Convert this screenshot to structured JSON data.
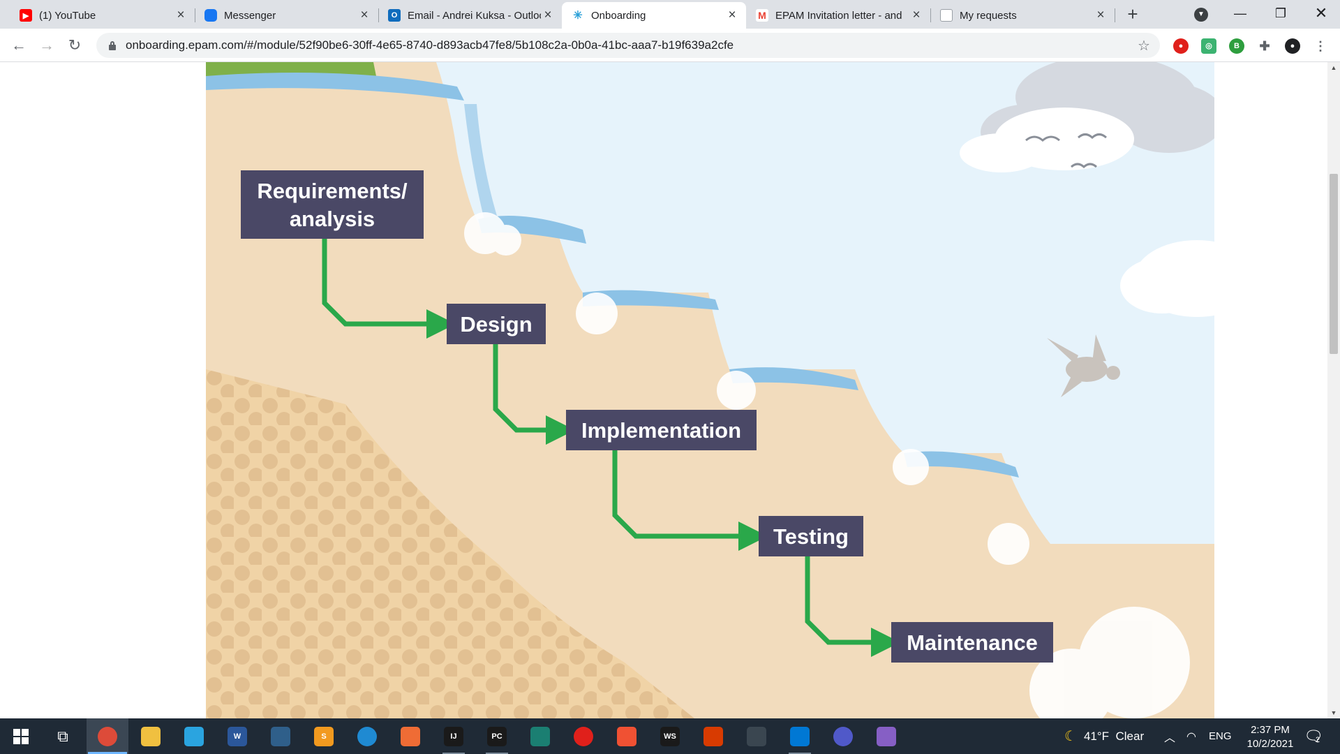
{
  "browser": {
    "tabs": [
      {
        "label": "(1) YouTube",
        "icon": "youtube-icon",
        "color": "#ff0000"
      },
      {
        "label": "Messenger",
        "icon": "messenger-icon",
        "color": "#1877f2"
      },
      {
        "label": "Email - Andrei Kuksa - Outlook",
        "icon": "outlook-icon",
        "color": "#0f6cbd"
      },
      {
        "label": "Onboarding",
        "icon": "onboarding-icon",
        "color": "#2aa0d8"
      },
      {
        "label": "EPAM Invitation letter - and",
        "icon": "gmail-icon",
        "color": "#ea4335"
      },
      {
        "label": "My requests",
        "icon": "document-icon",
        "color": "#9aa0a6"
      }
    ],
    "active_tab": 3,
    "url": "onboarding.epam.com/#/module/52f90be6-30ff-4e65-8740-d893acb47fe8/5b108c2a-0b0a-41bc-aaa7-b19f639a2cfe"
  },
  "diagram": {
    "steps": [
      "Requirements/\nanalysis",
      "Design",
      "Implementation",
      "Testing",
      "Maintenance"
    ],
    "colors": {
      "box": "#4a4866",
      "arrow": "#2aa84a",
      "sky": "#e6f3fb",
      "cliff": "#f2dcbd",
      "water": "#8cc2e6",
      "grass": "#7fb04a"
    }
  },
  "taskbar": {
    "apps": [
      {
        "name": "chrome-app",
        "label": "",
        "color": "#dd4b39"
      },
      {
        "name": "file-explorer-app",
        "label": "",
        "color": "#f0c040"
      },
      {
        "name": "telegram-app",
        "label": "",
        "color": "#2aa4e0"
      },
      {
        "name": "word-app",
        "label": "W",
        "color": "#2b579a"
      },
      {
        "name": "mysql-workbench-app",
        "label": "",
        "color": "#2f5f8a"
      },
      {
        "name": "sublime-text-app",
        "label": "S",
        "color": "#f29a1f"
      },
      {
        "name": "edge-app",
        "label": "",
        "color": "#1f8ad2"
      },
      {
        "name": "postman-app",
        "label": "",
        "color": "#ef6c35"
      },
      {
        "name": "intellij-idea-app",
        "label": "IJ",
        "color": "#1a1a1a"
      },
      {
        "name": "pycharm-app",
        "label": "PC",
        "color": "#1a1a1a"
      },
      {
        "name": "gitkraken-app",
        "label": "",
        "color": "#1b7f72"
      },
      {
        "name": "opera-app",
        "label": "",
        "color": "#e0201b"
      },
      {
        "name": "git-app",
        "label": "",
        "color": "#f05133"
      },
      {
        "name": "webstorm-app",
        "label": "WS",
        "color": "#1a1a1a"
      },
      {
        "name": "office-app",
        "label": "",
        "color": "#d83b01"
      },
      {
        "name": "vpn-app",
        "label": "",
        "color": "#3a4650"
      },
      {
        "name": "remote-desktop-app",
        "label": "",
        "color": "#0078d4"
      },
      {
        "name": "teams-app",
        "label": "",
        "color": "#5059c9"
      },
      {
        "name": "visual-studio-app",
        "label": "",
        "color": "#865fc5"
      }
    ],
    "weather": "41°F  Clear",
    "language": "ENG",
    "time": "2:37 PM",
    "date": "10/2/2021",
    "notifications": "2"
  }
}
